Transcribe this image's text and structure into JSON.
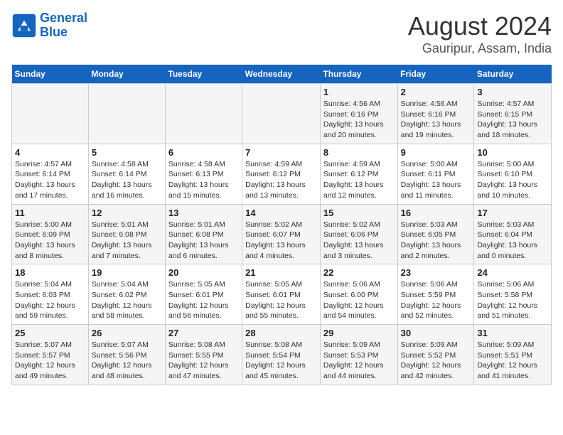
{
  "logo": {
    "line1": "General",
    "line2": "Blue"
  },
  "title": "August 2024",
  "subtitle": "Gauripur, Assam, India",
  "headers": [
    "Sunday",
    "Monday",
    "Tuesday",
    "Wednesday",
    "Thursday",
    "Friday",
    "Saturday"
  ],
  "weeks": [
    [
      {
        "day": "",
        "info": ""
      },
      {
        "day": "",
        "info": ""
      },
      {
        "day": "",
        "info": ""
      },
      {
        "day": "",
        "info": ""
      },
      {
        "day": "1",
        "info": "Sunrise: 4:56 AM\nSunset: 6:16 PM\nDaylight: 13 hours\nand 20 minutes."
      },
      {
        "day": "2",
        "info": "Sunrise: 4:56 AM\nSunset: 6:16 PM\nDaylight: 13 hours\nand 19 minutes."
      },
      {
        "day": "3",
        "info": "Sunrise: 4:57 AM\nSunset: 6:15 PM\nDaylight: 13 hours\nand 18 minutes."
      }
    ],
    [
      {
        "day": "4",
        "info": "Sunrise: 4:57 AM\nSunset: 6:14 PM\nDaylight: 13 hours\nand 17 minutes."
      },
      {
        "day": "5",
        "info": "Sunrise: 4:58 AM\nSunset: 6:14 PM\nDaylight: 13 hours\nand 16 minutes."
      },
      {
        "day": "6",
        "info": "Sunrise: 4:58 AM\nSunset: 6:13 PM\nDaylight: 13 hours\nand 15 minutes."
      },
      {
        "day": "7",
        "info": "Sunrise: 4:59 AM\nSunset: 6:12 PM\nDaylight: 13 hours\nand 13 minutes."
      },
      {
        "day": "8",
        "info": "Sunrise: 4:59 AM\nSunset: 6:12 PM\nDaylight: 13 hours\nand 12 minutes."
      },
      {
        "day": "9",
        "info": "Sunrise: 5:00 AM\nSunset: 6:11 PM\nDaylight: 13 hours\nand 11 minutes."
      },
      {
        "day": "10",
        "info": "Sunrise: 5:00 AM\nSunset: 6:10 PM\nDaylight: 13 hours\nand 10 minutes."
      }
    ],
    [
      {
        "day": "11",
        "info": "Sunrise: 5:00 AM\nSunset: 6:09 PM\nDaylight: 13 hours\nand 8 minutes."
      },
      {
        "day": "12",
        "info": "Sunrise: 5:01 AM\nSunset: 6:08 PM\nDaylight: 13 hours\nand 7 minutes."
      },
      {
        "day": "13",
        "info": "Sunrise: 5:01 AM\nSunset: 6:08 PM\nDaylight: 13 hours\nand 6 minutes."
      },
      {
        "day": "14",
        "info": "Sunrise: 5:02 AM\nSunset: 6:07 PM\nDaylight: 13 hours\nand 4 minutes."
      },
      {
        "day": "15",
        "info": "Sunrise: 5:02 AM\nSunset: 6:06 PM\nDaylight: 13 hours\nand 3 minutes."
      },
      {
        "day": "16",
        "info": "Sunrise: 5:03 AM\nSunset: 6:05 PM\nDaylight: 13 hours\nand 2 minutes."
      },
      {
        "day": "17",
        "info": "Sunrise: 5:03 AM\nSunset: 6:04 PM\nDaylight: 13 hours\nand 0 minutes."
      }
    ],
    [
      {
        "day": "18",
        "info": "Sunrise: 5:04 AM\nSunset: 6:03 PM\nDaylight: 12 hours\nand 59 minutes."
      },
      {
        "day": "19",
        "info": "Sunrise: 5:04 AM\nSunset: 6:02 PM\nDaylight: 12 hours\nand 58 minutes."
      },
      {
        "day": "20",
        "info": "Sunrise: 5:05 AM\nSunset: 6:01 PM\nDaylight: 12 hours\nand 56 minutes."
      },
      {
        "day": "21",
        "info": "Sunrise: 5:05 AM\nSunset: 6:01 PM\nDaylight: 12 hours\nand 55 minutes."
      },
      {
        "day": "22",
        "info": "Sunrise: 5:06 AM\nSunset: 6:00 PM\nDaylight: 12 hours\nand 54 minutes."
      },
      {
        "day": "23",
        "info": "Sunrise: 5:06 AM\nSunset: 5:59 PM\nDaylight: 12 hours\nand 52 minutes."
      },
      {
        "day": "24",
        "info": "Sunrise: 5:06 AM\nSunset: 5:58 PM\nDaylight: 12 hours\nand 51 minutes."
      }
    ],
    [
      {
        "day": "25",
        "info": "Sunrise: 5:07 AM\nSunset: 5:57 PM\nDaylight: 12 hours\nand 49 minutes."
      },
      {
        "day": "26",
        "info": "Sunrise: 5:07 AM\nSunset: 5:56 PM\nDaylight: 12 hours\nand 48 minutes."
      },
      {
        "day": "27",
        "info": "Sunrise: 5:08 AM\nSunset: 5:55 PM\nDaylight: 12 hours\nand 47 minutes."
      },
      {
        "day": "28",
        "info": "Sunrise: 5:08 AM\nSunset: 5:54 PM\nDaylight: 12 hours\nand 45 minutes."
      },
      {
        "day": "29",
        "info": "Sunrise: 5:09 AM\nSunset: 5:53 PM\nDaylight: 12 hours\nand 44 minutes."
      },
      {
        "day": "30",
        "info": "Sunrise: 5:09 AM\nSunset: 5:52 PM\nDaylight: 12 hours\nand 42 minutes."
      },
      {
        "day": "31",
        "info": "Sunrise: 5:09 AM\nSunset: 5:51 PM\nDaylight: 12 hours\nand 41 minutes."
      }
    ]
  ]
}
